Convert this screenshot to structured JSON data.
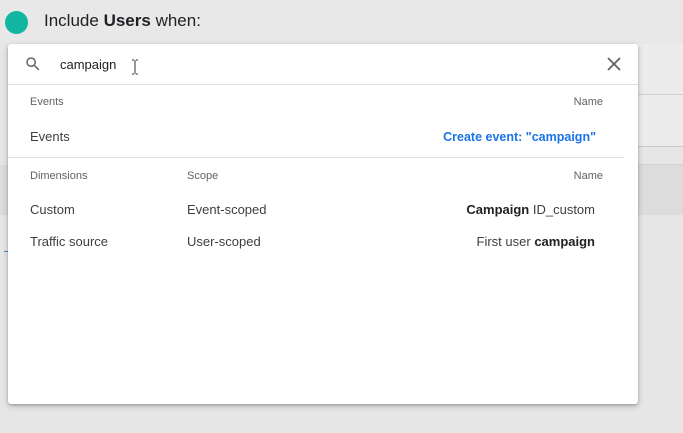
{
  "background": {
    "include_prefix": "Include",
    "include_bold": "Users",
    "include_suffix": "when:"
  },
  "search": {
    "value": "campaign",
    "placeholder": ""
  },
  "events_section": {
    "header_left": "Events",
    "header_right": "Name",
    "row_label": "Events",
    "create_event_label": "Create event: \"campaign\""
  },
  "dimensions_section": {
    "header_left": "Dimensions",
    "header_mid": "Scope",
    "header_right": "Name",
    "rows": [
      {
        "label": "Custom",
        "scope": "Event-scoped",
        "name_bold": "Campaign",
        "name_rest": "ID_custom"
      },
      {
        "label": "Traffic source",
        "scope": "User-scoped",
        "name_prefix": "First user",
        "name_bold": "campaign"
      }
    ]
  },
  "colors": {
    "accent_blue": "#1a73e8",
    "teal_dot": "#12b5a0"
  },
  "icons": [
    "search-icon",
    "close-icon",
    "text-cursor-icon"
  ]
}
